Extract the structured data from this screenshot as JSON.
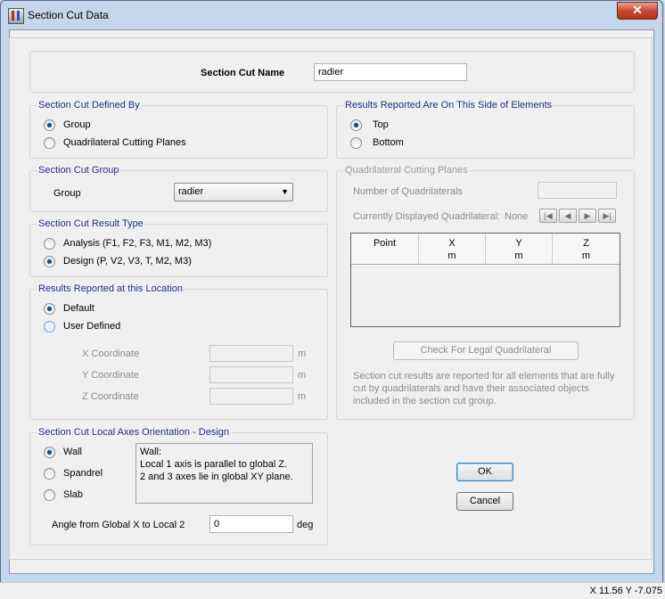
{
  "window": {
    "title": "Section Cut Data",
    "close": "✕"
  },
  "name_panel": {
    "label": "Section Cut Name",
    "value": "radier"
  },
  "defined_by": {
    "title": "Section Cut Defined By",
    "options": [
      "Group",
      "Quadrilateral Cutting Planes"
    ],
    "selected": "Group"
  },
  "reported_side": {
    "title": "Results Reported Are On This Side of Elements",
    "options": [
      "Top",
      "Bottom"
    ],
    "selected": "Top"
  },
  "cut_group": {
    "title": "Section Cut Group",
    "label": "Group",
    "value": "radier"
  },
  "result_type": {
    "title": "Section Cut Result Type",
    "options": [
      "Analysis  (F1, F2, F3, M1, M2, M3)",
      "Design  (P, V2, V3, T, M2, M3)"
    ],
    "selected": "Design  (P, V2, V3, T, M2, M3)"
  },
  "location": {
    "title": "Results Reported at this Location",
    "options": [
      "Default",
      "User Defined"
    ],
    "selected": "Default",
    "coords": [
      {
        "label": "X  Coordinate",
        "unit": "m"
      },
      {
        "label": "Y  Coordinate",
        "unit": "m"
      },
      {
        "label": "Z  Coordinate",
        "unit": "m"
      }
    ]
  },
  "local_axes": {
    "title": "Section Cut Local Axes Orientation - Design",
    "options": [
      "Wall",
      "Spandrel",
      "Slab"
    ],
    "selected": "Wall",
    "description": [
      "Wall:",
      "Local 1 axis is parallel to global Z.",
      "2 and 3 axes lie in global XY plane."
    ],
    "angle_label": "Angle from Global X to Local 2",
    "angle_value": "0",
    "angle_unit": "deg"
  },
  "quad_planes": {
    "title": "Quadrilateral Cutting Planes",
    "num_label": "Number of Quadrilaterals",
    "displayed_label": "Currently Displayed Quadrilateral:",
    "displayed_value": "None",
    "nav": [
      "first",
      "previous",
      "next",
      "last"
    ],
    "columns": [
      {
        "name": "Point",
        "unit": ""
      },
      {
        "name": "X",
        "unit": "m"
      },
      {
        "name": "Y",
        "unit": "m"
      },
      {
        "name": "Z",
        "unit": "m"
      }
    ],
    "check_button": "Check For Legal Quadrilateral",
    "note": [
      "Section cut results are reported for all elements that are fully",
      "cut by quadrilaterals and have their associated objects",
      "included in the section cut group."
    ]
  },
  "buttons": {
    "ok": "OK",
    "cancel": "Cancel"
  },
  "status": {
    "text": "X 11.56  Y -7.075"
  }
}
